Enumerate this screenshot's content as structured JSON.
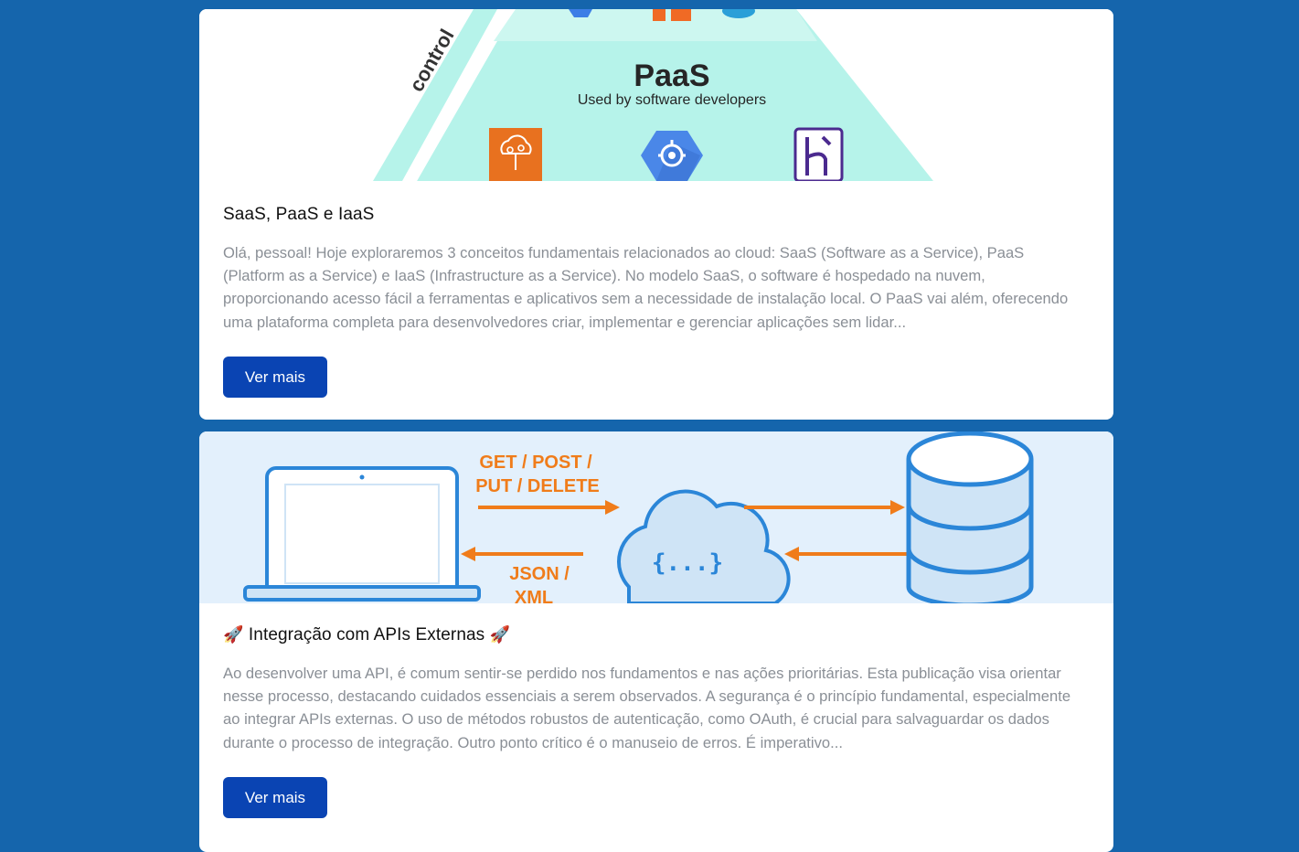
{
  "posts": [
    {
      "hero": {
        "side_label": "control",
        "headline": "PaaS",
        "subline": "Used by software developers",
        "icons": [
          "cloud-tree-icon",
          "gcp-hexagon-icon",
          "heroku-icon"
        ]
      },
      "title": "SaaS, PaaS e IaaS",
      "excerpt": "Olá, pessoal! Hoje exploraremos 3 conceitos fundamentais relacionados ao cloud: SaaS (Software as a Service), PaaS (Platform as a Service) e IaaS (Infrastructure as a Service). No modelo SaaS, o software é hospedado na nuvem, proporcionando acesso fácil a ferramentas e aplicativos sem a necessidade de instalação local. O PaaS vai além, oferecendo uma plataforma completa para desenvolvedores criar, implementar e gerenciar aplicações sem lidar...",
      "button_label": "Ver mais"
    },
    {
      "hero": {
        "request_line1": "GET / POST /",
        "request_line2": "PUT / DELETE",
        "response_line1": "JSON /",
        "response_line2": "XML",
        "cloud_label": "{...}",
        "icons": [
          "laptop-icon",
          "cloud-icon",
          "database-icon"
        ]
      },
      "title_emoji": "🚀",
      "title": "Integração com APIs Externas",
      "excerpt": "Ao desenvolver uma API, é comum sentir-se perdido nos fundamentos e nas ações prioritárias. Esta publicação visa orientar nesse processo, destacando cuidados essenciais a serem observados. A segurança é o princípio fundamental, especialmente ao integrar APIs externas. O uso de métodos robustos de autenticação, como OAuth, é crucial para salvaguardar os dados durante o processo de integração. Outro ponto crítico é o manuseio de erros. É imperativo...",
      "button_label": "Ver mais"
    }
  ],
  "colors": {
    "page_background": "#1565ac",
    "button": "#0a44b3",
    "pyramid": "#b6f3ea",
    "api_accent": "#f07c1a",
    "api_blue": "#2b86d8"
  }
}
